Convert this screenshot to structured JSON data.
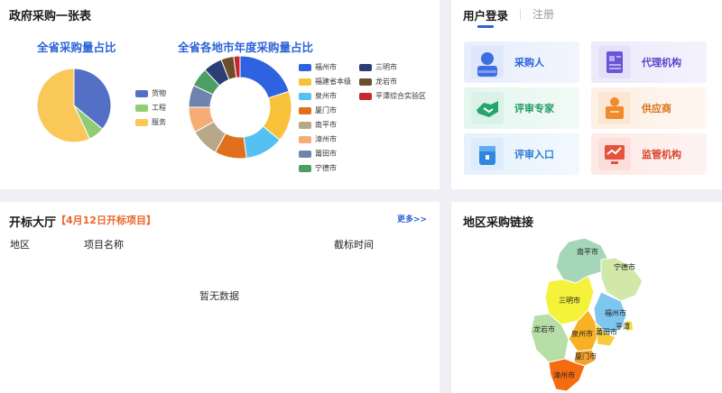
{
  "procurement": {
    "title": "政府采购一张表",
    "pie_title": "全省采购量占比",
    "donut_title": "全省各地市年度采购量占比"
  },
  "chart_data": [
    {
      "type": "pie",
      "title": "全省采购量占比",
      "categories": [
        "货物",
        "工程",
        "服务"
      ],
      "values": [
        36,
        7,
        57
      ],
      "colors": [
        "#5470c6",
        "#91cc75",
        "#fac858"
      ],
      "legend": "right"
    },
    {
      "type": "pie",
      "title": "全省各地市年度采购量占比",
      "categories": [
        "福州市",
        "福建省本级",
        "泉州市",
        "厦门市",
        "南平市",
        "漳州市",
        "莆田市",
        "宁德市",
        "三明市",
        "龙岩市",
        "平潭综合实验区"
      ],
      "values": [
        20,
        16,
        12,
        10,
        9,
        8,
        7,
        6,
        6,
        4,
        2
      ],
      "colors": [
        "#2d63e0",
        "#f8c13a",
        "#55c1f3",
        "#e0701d",
        "#b8a88a",
        "#f4ae75",
        "#6f83b0",
        "#4b9f63",
        "#2b3f75",
        "#6b4f2c",
        "#c8282d"
      ],
      "legend": "right"
    }
  ],
  "login": {
    "tab_login": "用户登录",
    "tab_register": "注册",
    "tiles": [
      {
        "label": "采购人",
        "icon": "person-icon"
      },
      {
        "label": "代理机构",
        "icon": "document-icon"
      },
      {
        "label": "评审专家",
        "icon": "handshake-icon"
      },
      {
        "label": "供应商",
        "icon": "supplier-icon"
      },
      {
        "label": "评审入口",
        "icon": "bag-icon"
      },
      {
        "label": "监管机构",
        "icon": "monitor-icon"
      }
    ]
  },
  "bid_hall": {
    "title": "开标大厅",
    "subtitle": "【4月12日开标项目】",
    "more": "更多>>",
    "columns": [
      "地区",
      "项目名称",
      "截标时间"
    ],
    "empty": "暂无数据"
  },
  "region": {
    "title": "地区采购链接",
    "cities": [
      "南平市",
      "宁德市",
      "三明市",
      "福州市",
      "龙岩市",
      "泉州市",
      "莆田市",
      "平潭",
      "厦门市",
      "漳州市"
    ]
  }
}
